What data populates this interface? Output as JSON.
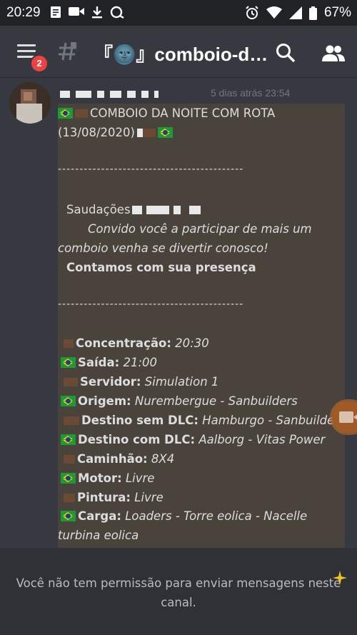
{
  "status_bar": {
    "time": "20:29",
    "battery": "67%",
    "left_icons": [
      "note-icon",
      "video-call-icon",
      "download-icon",
      "sync-icon"
    ],
    "right_icons": [
      "alarm-icon",
      "wifi-icon",
      "signal-icon",
      "battery-icon"
    ]
  },
  "header": {
    "menu_badge": "2",
    "channel_name": "『🌚』comboio-d…",
    "icons": [
      "hamburger-menu-icon",
      "locked-channel-hash-icon",
      "search-icon",
      "members-icon"
    ]
  },
  "message": {
    "timestamp": "5 dias atrás 23:54",
    "lines": {
      "l1": "COMBOIO DA NOITE COM ROTA",
      "l2": "(13/08/2020)",
      "div1": "-------------------------------------------",
      "greeting": "Saudações",
      "invite1": "Convido você a participar de mais um",
      "invite2": "comboio venha se divertir conosco!",
      "presence": "Contamos com sua presença",
      "div2": "-------------------------------------------"
    },
    "details": [
      {
        "label": "Concentração:",
        "value": "20:30"
      },
      {
        "label": "Saída:",
        "value": "21:00"
      },
      {
        "label": "Servidor:",
        "value": "Simulation 1"
      },
      {
        "label": "Origem:",
        "value": "Nurembergue - Sanbuilders"
      },
      {
        "label": "Destino sem DLC:",
        "value": "Hamburgo - Sanbuilders"
      },
      {
        "label": "Destino com DLC:",
        "value": "Aalborg - Vitas Power"
      },
      {
        "label": "Caminhão:",
        "value": "8X4"
      },
      {
        "label": "Motor:",
        "value": "Livre"
      },
      {
        "label": "Pintura:",
        "value": "Livre"
      },
      {
        "label": "Carga:",
        "value": "Loaders - Torre eolica - Nacelle"
      }
    ],
    "carga_cont": "turbina eolica"
  },
  "footer": {
    "text": "Você não tem permissão para enviar mensagens neste canal."
  },
  "colors": {
    "background": "#36393f",
    "status_bar": "#202225",
    "message_highlight": "#4a433c",
    "badge": "#ed4245",
    "footer": "#2f3136"
  }
}
